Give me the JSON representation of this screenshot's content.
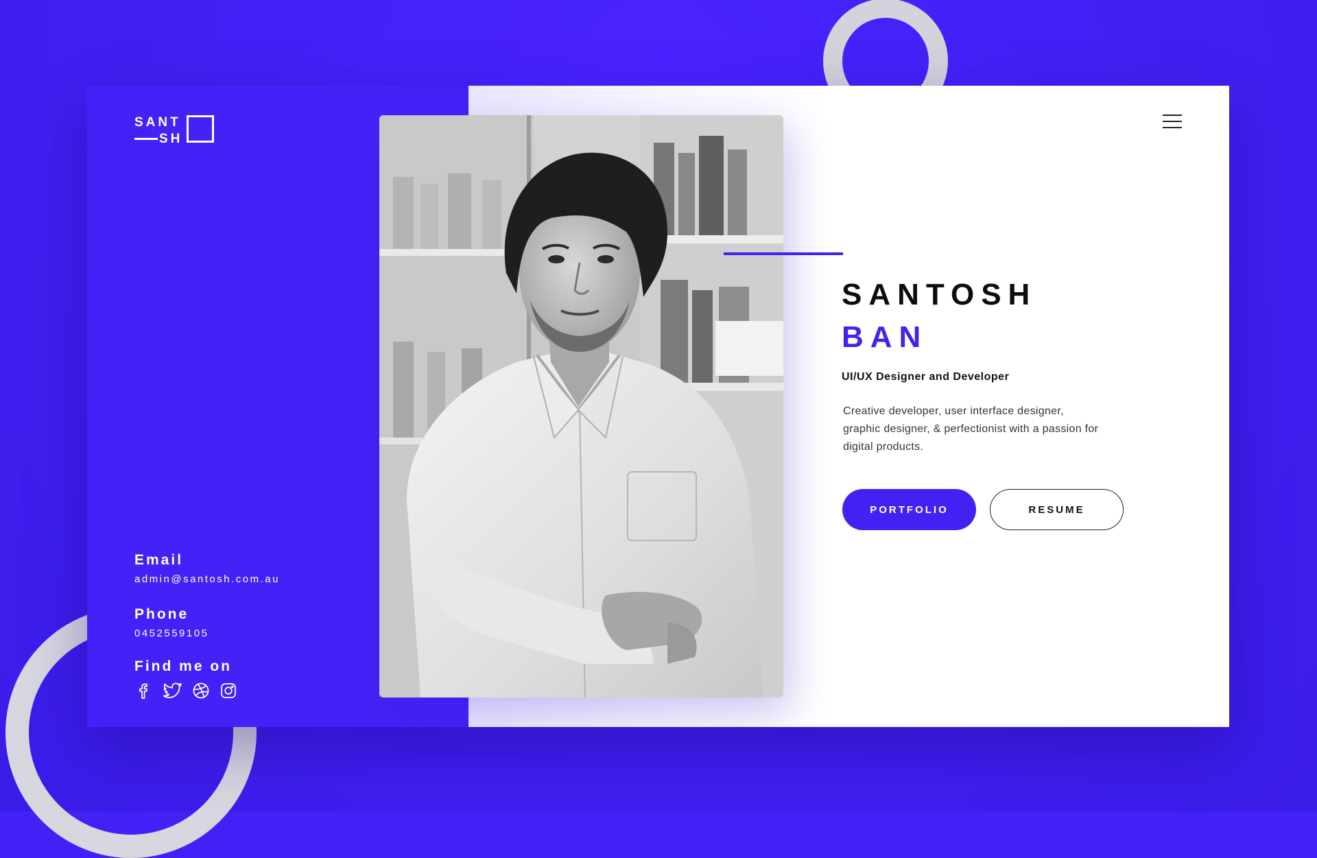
{
  "logo": {
    "line1": "SANT",
    "line2": "SH"
  },
  "contact": {
    "email_label": "Email",
    "email_value": "admin@santosh.com.au",
    "phone_label": "Phone",
    "phone_value": "0452559105",
    "find_label": "Find me on",
    "socials": [
      {
        "icon": "facebook-icon"
      },
      {
        "icon": "twitter-icon"
      },
      {
        "icon": "dribbble-icon"
      },
      {
        "icon": "instagram-icon"
      }
    ]
  },
  "hero": {
    "first_name": "SANTOSH",
    "last_name": "BAN",
    "role": "UI/UX Designer and Developer",
    "bio": "Creative developer, user interface designer, graphic designer, & perfectionist with a passion for digital products."
  },
  "buttons": {
    "portfolio": "PORTFOLIO",
    "resume": "RESUME"
  },
  "colors": {
    "background": "#4320f5",
    "accent": "#4521ef",
    "ring": "#d5d5de",
    "text_dark": "#0d0d0d"
  },
  "icons": {
    "menu": "hamburger-menu-icon"
  }
}
